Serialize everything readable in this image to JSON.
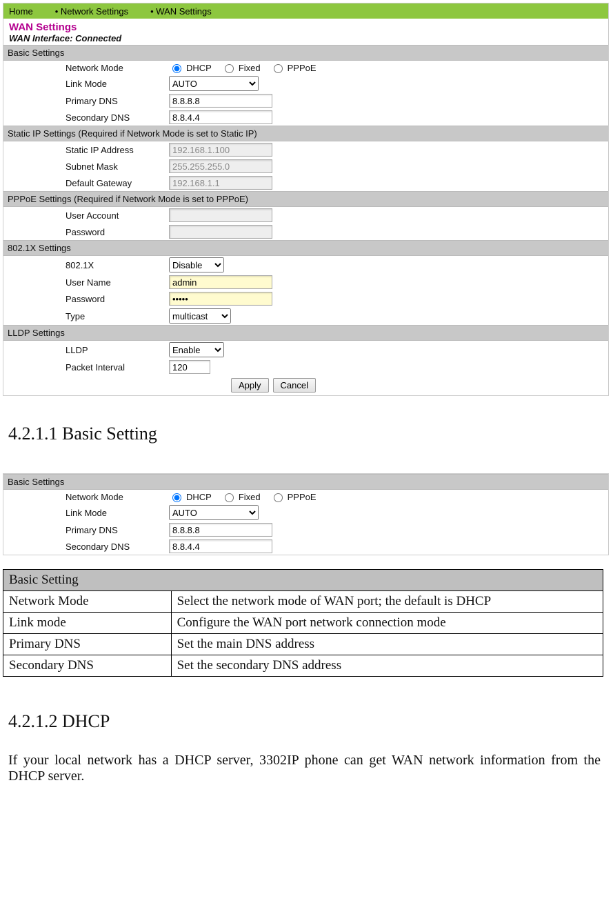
{
  "breadcrumb": {
    "home": "Home",
    "net": "Network Settings",
    "wan": "WAN Settings"
  },
  "page": {
    "title": "WAN Settings",
    "iface": "WAN Interface: Connected"
  },
  "sections": {
    "basic": "Basic Settings",
    "static": "Static IP Settings (Required if Network Mode is set to Static IP)",
    "pppoe": "PPPoE Settings (Required if Network Mode is set to PPPoE)",
    "dot1x": "802.1X Settings",
    "lldp": "LLDP Settings"
  },
  "labels": {
    "network_mode": "Network Mode",
    "link_mode": "Link Mode",
    "primary_dns": "Primary DNS",
    "secondary_dns": "Secondary DNS",
    "static_ip": "Static IP Address",
    "subnet": "Subnet Mask",
    "gateway": "Default Gateway",
    "user_account": "User Account",
    "password": "Password",
    "dot1x": "802.1X",
    "user_name": "User Name",
    "type": "Type",
    "lldp": "LLDP",
    "packet_interval": "Packet Interval"
  },
  "radio": {
    "dhcp": "DHCP",
    "fixed": "Fixed",
    "pppoe": "PPPoE"
  },
  "values": {
    "link_mode": "AUTO",
    "primary_dns": "8.8.8.8",
    "secondary_dns": "8.8.4.4",
    "static_ip": "192.168.1.100",
    "subnet": "255.255.255.0",
    "gateway": "192.168.1.1",
    "user_account": "",
    "pppoe_password": "",
    "dot1x": "Disable",
    "user_name": "admin",
    "dot1x_password": "•••••",
    "type": "multicast",
    "lldp": "Enable",
    "packet_interval": "120"
  },
  "buttons": {
    "apply": "Apply",
    "cancel": "Cancel"
  },
  "doc": {
    "h1": "4.2.1.1 Basic Setting",
    "h2": "4.2.1.2 DHCP",
    "p2": "If your local network has a DHCP server, 3302IP phone can get WAN network information from the DHCP server."
  },
  "table": {
    "title": "Basic Setting",
    "rows": [
      {
        "k": "Network Mode",
        "v": "Select the network mode of WAN port; the default is DHCP"
      },
      {
        "k": "Link mode",
        "v": "Configure the WAN port network connection mode"
      },
      {
        "k": "Primary DNS",
        "v": "Set the main DNS address"
      },
      {
        "k": "Secondary DNS",
        "v": "Set the secondary DNS address"
      }
    ]
  }
}
